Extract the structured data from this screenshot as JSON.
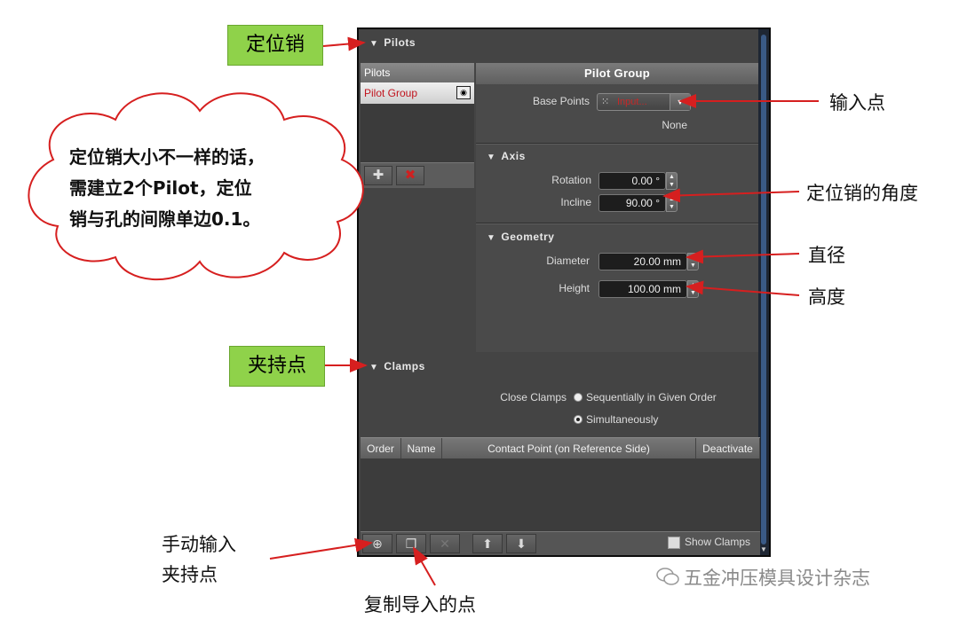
{
  "pilots_section": {
    "header": "Pilots",
    "list_header": "Pilots",
    "list_item": "Pilot Group",
    "group_title": "Pilot Group",
    "base_points_label": "Base Points",
    "base_points_value": "Input...",
    "base_points_status": "None"
  },
  "axis_section": {
    "header": "Axis",
    "rotation_label": "Rotation",
    "rotation_value": "0.00 °",
    "incline_label": "Incline",
    "incline_value": "90.00 °"
  },
  "geometry_section": {
    "header": "Geometry",
    "diameter_label": "Diameter",
    "diameter_value": "20.00 mm",
    "height_label": "Height",
    "height_value": "100.00 mm"
  },
  "clamps_section": {
    "header": "Clamps",
    "close_clamps_label": "Close Clamps",
    "option_sequential": "Sequentially in Given Order",
    "option_simultaneous": "Simultaneously",
    "selected_option": "Simultaneously",
    "columns": [
      "Order",
      "Name",
      "Contact Point (on Reference Side)",
      "Deactivate"
    ],
    "show_clamps_label": "Show Clamps"
  },
  "annotations": {
    "pilot_box": "定位销",
    "clamp_box": "夹持点",
    "cloud_line1": "定位销大小不一样的话，",
    "cloud_line2": "需建立2个Pilot，定位",
    "cloud_line3": "销与孔的间隙单边0.1。",
    "input_point": "输入点",
    "pin_angle": "定位销的角度",
    "diameter": "直径",
    "height": "高度",
    "manual_line1": "手动输入",
    "manual_line2": "夹持点",
    "copy_imported": "复制导入的点",
    "watermark": "五金冲压模具设计杂志"
  },
  "colors": {
    "annotation_green": "#8fd24a",
    "arrow_red": "#d61f1f",
    "panel_bg": "#444444",
    "selected_red": "#c0131d"
  },
  "icons": [
    "triangle-down-icon",
    "eye-icon",
    "add-pilot-icon",
    "delete-icon",
    "points-icon",
    "chevron-down-icon",
    "spin-icon",
    "add-clamp-icon",
    "copy-icon",
    "arrow-up-icon",
    "arrow-down-icon",
    "wechat-icon"
  ]
}
